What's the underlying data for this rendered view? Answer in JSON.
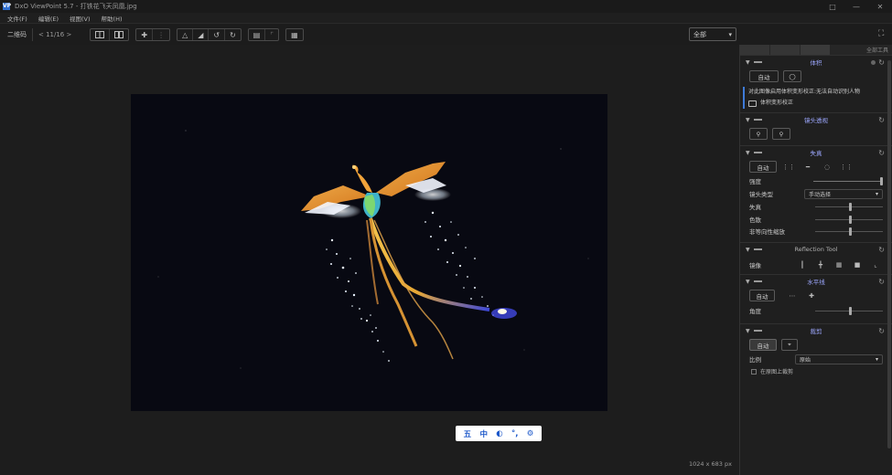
{
  "window": {
    "title": "DxO ViewPoint 5.7 - 打铁花飞天凤凰.jpg",
    "app_icon": "VP"
  },
  "menu": [
    "文件(F)",
    "编辑(E)",
    "视图(V)",
    "帮助(H)"
  ],
  "toolbar": {
    "label": "二维码",
    "page": "< 11/16 >",
    "right_dropdown": "全部"
  },
  "viewer": {
    "dimensions": "1024 x 683 px"
  },
  "ime": {
    "chars": [
      "五",
      "中",
      "◐",
      "°,",
      "⚙"
    ]
  },
  "panel": {
    "header_label": "全部工具",
    "sections": {
      "volume": {
        "title": "体积",
        "btn_auto": "自动",
        "info_text": "对此图像启用体积变形校正:无法自动识别人物",
        "folder_text": "体积变形校正"
      },
      "perspective": {
        "title": "镜头透视"
      },
      "distortion": {
        "title": "失真",
        "btn_auto": "自动",
        "slider_intensity": "强度",
        "lens_label": "镜头类型",
        "lens_value": "手动选择",
        "slider_a": "失真",
        "slider_b": "色散",
        "slider_c": "非等向性缩放"
      },
      "reflection": {
        "title": "Reflection Tool",
        "label": "镜像"
      },
      "horizon": {
        "title": "水平线",
        "btn_auto": "自动",
        "slider_label": "角度"
      },
      "crop": {
        "title": "裁剪",
        "btn_auto": "自动",
        "ratio_label": "比例",
        "ratio_value": "原始",
        "checkbox_label": "在原图上裁剪"
      }
    }
  },
  "colors": {
    "accent": "#3e7bd8",
    "section_title": "#9da8ff"
  }
}
